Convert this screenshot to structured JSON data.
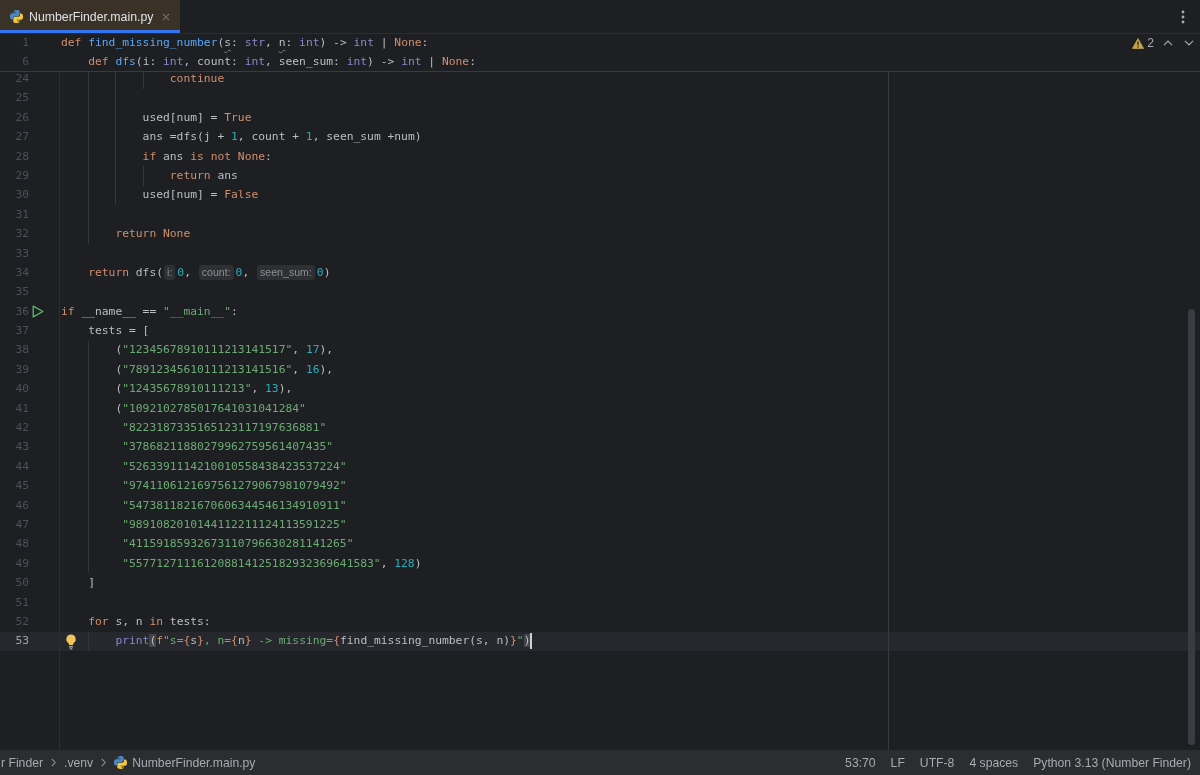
{
  "tabs": [
    {
      "label": "NumberFinder.main.py",
      "selected": true
    }
  ],
  "inspections": {
    "warnings": "2"
  },
  "sticky_lines": [
    {
      "number": "1",
      "tokens": [
        {
          "kind": "keyword",
          "text": "def"
        },
        {
          "kind": "function",
          "text": " find_missing_number"
        },
        {
          "kind": "plain",
          "text": "("
        },
        {
          "kind": "param",
          "text": "s"
        },
        {
          "kind": "plain",
          "text": ": "
        },
        {
          "kind": "type",
          "text": "str"
        },
        {
          "kind": "plain",
          "text": ", "
        },
        {
          "kind": "param",
          "text": "n"
        },
        {
          "kind": "plain",
          "text": ": "
        },
        {
          "kind": "type",
          "text": "int"
        },
        {
          "kind": "plain",
          "text": ") -> "
        },
        {
          "kind": "type",
          "text": "int"
        },
        {
          "kind": "plain",
          "text": " | "
        },
        {
          "kind": "keyword",
          "text": "None"
        },
        {
          "kind": "plain",
          "text": ":"
        }
      ]
    },
    {
      "number": "6",
      "tokens": [
        {
          "kind": "keyword",
          "text": "    def"
        },
        {
          "kind": "function",
          "text": " dfs"
        },
        {
          "kind": "plain",
          "text": "(i: "
        },
        {
          "kind": "type",
          "text": "int"
        },
        {
          "kind": "plain",
          "text": ", count: "
        },
        {
          "kind": "type",
          "text": "int"
        },
        {
          "kind": "plain",
          "text": ", seen_sum: "
        },
        {
          "kind": "type",
          "text": "int"
        },
        {
          "kind": "plain",
          "text": ") -> "
        },
        {
          "kind": "type",
          "text": "int"
        },
        {
          "kind": "plain",
          "text": " | "
        },
        {
          "kind": "keyword",
          "text": "None"
        },
        {
          "kind": "plain",
          "text": ":"
        }
      ]
    }
  ],
  "lines": [
    {
      "number": "24",
      "current": false,
      "run_marker": false,
      "bulb": false,
      "tokens": [
        {
          "kind": "keyword",
          "text": "                continue"
        }
      ]
    },
    {
      "number": "25",
      "current": false,
      "run_marker": false,
      "bulb": false
    },
    {
      "number": "26",
      "current": false,
      "run_marker": false,
      "bulb": false,
      "tokens": [
        {
          "kind": "plain",
          "text": "            used[num] = "
        },
        {
          "kind": "keyword",
          "text": "True"
        }
      ]
    },
    {
      "number": "27",
      "current": false,
      "run_marker": false,
      "bulb": false,
      "tokens": [
        {
          "kind": "plain",
          "text": "            ans =dfs(j + "
        },
        {
          "kind": "number",
          "text": "1"
        },
        {
          "kind": "plain",
          "text": ", count + "
        },
        {
          "kind": "number",
          "text": "1"
        },
        {
          "kind": "plain",
          "text": ", seen_sum +num)"
        }
      ]
    },
    {
      "number": "28",
      "current": false,
      "run_marker": false,
      "bulb": false,
      "tokens": [
        {
          "kind": "keyword",
          "text": "            if"
        },
        {
          "kind": "plain",
          "text": " ans "
        },
        {
          "kind": "keyword",
          "text": "is not None"
        },
        {
          "kind": "plain",
          "text": ":"
        }
      ]
    },
    {
      "number": "29",
      "current": false,
      "run_marker": false,
      "bulb": false,
      "tokens": [
        {
          "kind": "keyword",
          "text": "                return"
        },
        {
          "kind": "plain",
          "text": " ans"
        }
      ]
    },
    {
      "number": "30",
      "current": false,
      "run_marker": false,
      "bulb": false,
      "tokens": [
        {
          "kind": "plain",
          "text": "            used[num] = "
        },
        {
          "kind": "keyword",
          "text": "False"
        }
      ]
    },
    {
      "number": "31",
      "current": false,
      "run_marker": false,
      "bulb": false
    },
    {
      "number": "32",
      "current": false,
      "run_marker": false,
      "bulb": false,
      "tokens": [
        {
          "kind": "keyword",
          "text": "        return None"
        }
      ]
    },
    {
      "number": "33",
      "current": false,
      "run_marker": false,
      "bulb": false
    },
    {
      "number": "34",
      "current": false,
      "run_marker": false,
      "bulb": false,
      "tokens": [
        {
          "kind": "keyword",
          "text": "    return"
        },
        {
          "kind": "plain",
          "text": " dfs("
        },
        {
          "kind": "hint",
          "text": "i:"
        },
        {
          "kind": "number",
          "text": "0"
        },
        {
          "kind": "plain",
          "text": ", "
        },
        {
          "kind": "hint",
          "text": "count:"
        },
        {
          "kind": "number",
          "text": "0"
        },
        {
          "kind": "plain",
          "text": ", "
        },
        {
          "kind": "hint",
          "text": "seen_sum:"
        },
        {
          "kind": "number",
          "text": "0"
        },
        {
          "kind": "plain",
          "text": ")"
        }
      ]
    },
    {
      "number": "35",
      "current": false,
      "run_marker": false,
      "bulb": false
    },
    {
      "number": "36",
      "current": false,
      "run_marker": true,
      "bulb": false,
      "tokens": [
        {
          "kind": "keyword",
          "text": "if"
        },
        {
          "kind": "plain",
          "text": " __name__ == "
        },
        {
          "kind": "string",
          "text": "\"__main__\""
        },
        {
          "kind": "plain",
          "text": ":"
        }
      ]
    },
    {
      "number": "37",
      "current": false,
      "run_marker": false,
      "bulb": false,
      "tokens": [
        {
          "kind": "plain",
          "text": "    tests = ["
        }
      ]
    },
    {
      "number": "38",
      "current": false,
      "run_marker": false,
      "bulb": false,
      "tokens": [
        {
          "kind": "plain",
          "text": "        ("
        },
        {
          "kind": "string",
          "text": "\"12345678910111213141517\""
        },
        {
          "kind": "plain",
          "text": ", "
        },
        {
          "kind": "number",
          "text": "17"
        },
        {
          "kind": "plain",
          "text": "),"
        }
      ]
    },
    {
      "number": "39",
      "current": false,
      "run_marker": false,
      "bulb": false,
      "tokens": [
        {
          "kind": "plain",
          "text": "        ("
        },
        {
          "kind": "string",
          "text": "\"78912345610111213141516\""
        },
        {
          "kind": "plain",
          "text": ", "
        },
        {
          "kind": "number",
          "text": "16"
        },
        {
          "kind": "plain",
          "text": "),"
        }
      ]
    },
    {
      "number": "40",
      "current": false,
      "run_marker": false,
      "bulb": false,
      "tokens": [
        {
          "kind": "plain",
          "text": "        ("
        },
        {
          "kind": "string",
          "text": "\"12435678910111213\""
        },
        {
          "kind": "plain",
          "text": ", "
        },
        {
          "kind": "number",
          "text": "13"
        },
        {
          "kind": "plain",
          "text": "),"
        }
      ]
    },
    {
      "number": "41",
      "current": false,
      "run_marker": false,
      "bulb": false,
      "tokens": [
        {
          "kind": "plain",
          "text": "        ("
        },
        {
          "kind": "string",
          "text": "\"1092102785017641031041284\""
        }
      ]
    },
    {
      "number": "42",
      "current": false,
      "run_marker": false,
      "bulb": false,
      "tokens": [
        {
          "kind": "string",
          "text": "         \"8223187335165123117197636881\""
        }
      ]
    },
    {
      "number": "43",
      "current": false,
      "run_marker": false,
      "bulb": false,
      "tokens": [
        {
          "kind": "string",
          "text": "         \"37868211880279962759561407435\""
        }
      ]
    },
    {
      "number": "44",
      "current": false,
      "run_marker": false,
      "bulb": false,
      "tokens": [
        {
          "kind": "string",
          "text": "         \"5263391114210010558438423537224\""
        }
      ]
    },
    {
      "number": "45",
      "current": false,
      "run_marker": false,
      "bulb": false,
      "tokens": [
        {
          "kind": "string",
          "text": "         \"9741106121697561279067981079492\""
        }
      ]
    },
    {
      "number": "46",
      "current": false,
      "run_marker": false,
      "bulb": false,
      "tokens": [
        {
          "kind": "string",
          "text": "         \"5473811821670606344546134910911\""
        }
      ]
    },
    {
      "number": "47",
      "current": false,
      "run_marker": false,
      "bulb": false,
      "tokens": [
        {
          "kind": "string",
          "text": "         \"9891082010144112211124113591225\""
        }
      ]
    },
    {
      "number": "48",
      "current": false,
      "run_marker": false,
      "bulb": false,
      "tokens": [
        {
          "kind": "string",
          "text": "         \"41159185932673110796630281141265\""
        }
      ]
    },
    {
      "number": "49",
      "current": false,
      "run_marker": false,
      "bulb": false,
      "tokens": [
        {
          "kind": "string",
          "text": "         \"557712711161208814125182932369641583\""
        },
        {
          "kind": "plain",
          "text": ", "
        },
        {
          "kind": "number",
          "text": "128"
        },
        {
          "kind": "plain",
          "text": ")"
        }
      ]
    },
    {
      "number": "50",
      "current": false,
      "run_marker": false,
      "bulb": false,
      "tokens": [
        {
          "kind": "plain",
          "text": "    ]"
        }
      ]
    },
    {
      "number": "51",
      "current": false,
      "run_marker": false,
      "bulb": false
    },
    {
      "number": "52",
      "current": false,
      "run_marker": false,
      "bulb": false,
      "tokens": [
        {
          "kind": "keyword",
          "text": "    for"
        },
        {
          "kind": "plain",
          "text": " s, n "
        },
        {
          "kind": "keyword",
          "text": "in"
        },
        {
          "kind": "plain",
          "text": " tests:"
        }
      ]
    },
    {
      "number": "53",
      "current": true,
      "run_marker": false,
      "bulb": true,
      "tokens": [
        {
          "kind": "builtin",
          "text": "        print"
        },
        {
          "kind": "bracket",
          "text": "("
        },
        {
          "kind": "keyword",
          "text": "f"
        },
        {
          "kind": "string",
          "text": "\"s="
        },
        {
          "kind": "brace",
          "text": "{"
        },
        {
          "kind": "plain",
          "text": "s"
        },
        {
          "kind": "brace",
          "text": "}"
        },
        {
          "kind": "string",
          "text": ", n="
        },
        {
          "kind": "brace",
          "text": "{"
        },
        {
          "kind": "plain",
          "text": "n"
        },
        {
          "kind": "brace",
          "text": "}"
        },
        {
          "kind": "string",
          "text": " -> missing="
        },
        {
          "kind": "brace",
          "text": "{"
        },
        {
          "kind": "plain",
          "text": "find_missing_number(s, n)"
        },
        {
          "kind": "brace",
          "text": "}"
        },
        {
          "kind": "string",
          "text": "\""
        },
        {
          "kind": "bracket",
          "text": ")"
        }
      ]
    }
  ],
  "status_bar": {
    "breadcrumbs": [
      {
        "label": "r Finder",
        "kind": "folder"
      },
      {
        "label": ".venv",
        "kind": "folder"
      },
      {
        "label": "NumberFinder.main.py",
        "kind": "file"
      }
    ],
    "widgets": [
      "53:70",
      "LF",
      "UTF-8",
      "4 spaces",
      "Python 3.13 (Number Finder)"
    ]
  }
}
